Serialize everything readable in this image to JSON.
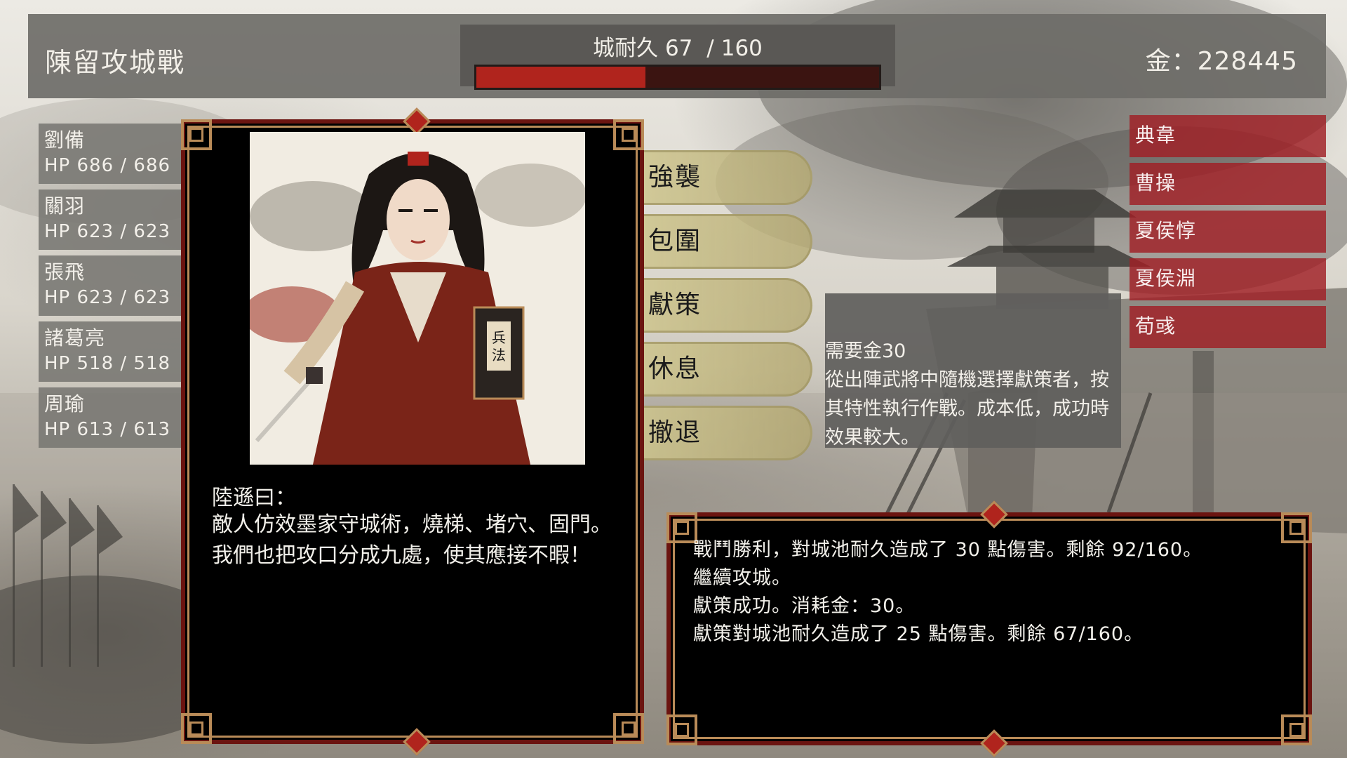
{
  "battle": {
    "title": "陳留攻城戰",
    "durability_label": "城耐久",
    "durability_current": "67",
    "durability_sep": "/",
    "durability_max": "160",
    "durability_fraction": 0.419
  },
  "gold": {
    "label": "金：228445"
  },
  "officers": [
    {
      "name": "劉備",
      "hp": "HP 686 / 686"
    },
    {
      "name": "關羽",
      "hp": "HP 623 / 623"
    },
    {
      "name": "張飛",
      "hp": "HP 623 / 623"
    },
    {
      "name": "諸葛亮",
      "hp": "HP 518 / 518"
    },
    {
      "name": "周瑜",
      "hp": "HP 613 / 613"
    }
  ],
  "advisor": {
    "speaker": "陸遜曰：",
    "quote": "敵人仿效墨家守城術，燒梯、堵穴、固門。我們也把攻口分成九處，使其應接不暇！",
    "book_text": "兵法"
  },
  "commands": [
    "強襲",
    "包圍",
    "獻策",
    "休息",
    "撤退"
  ],
  "tooltip": {
    "cost": "需要金30",
    "description": "從出陣武將中隨機選擇獻策者，按其特性執行作戰。成本低，成功時效果較大。"
  },
  "enemies": [
    "典韋",
    "曹操",
    "夏侯惇",
    "夏侯淵",
    "荀彧"
  ],
  "log": [
    "戰鬥勝利，對城池耐久造成了 30 點傷害。剩餘 92/160。",
    "繼續攻城。",
    "獻策成功。消耗金：30。",
    "獻策對城池耐久造成了 25 點傷害。剩餘 67/160。"
  ],
  "colors": {
    "durability_fill": "#b0241d",
    "enemy_bg": "#a01e24",
    "frame_red": "#6b1410",
    "frame_gold": "#b98b58",
    "command_bg": "#cdc48c"
  }
}
